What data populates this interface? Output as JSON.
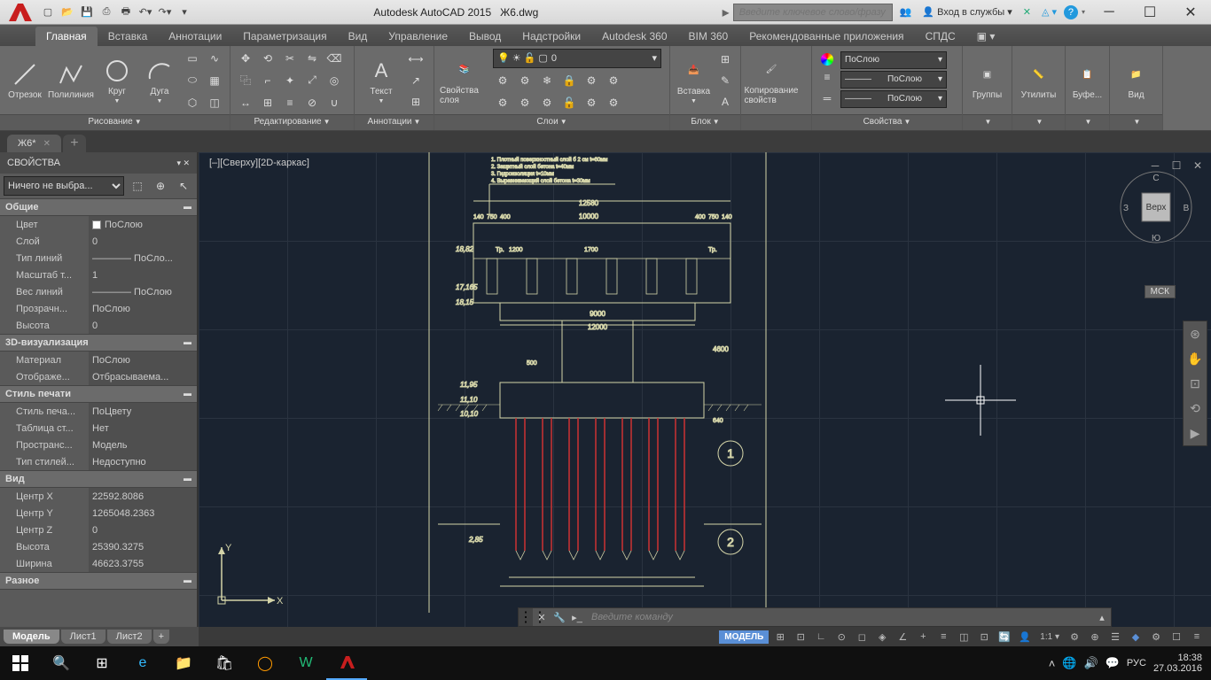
{
  "app": {
    "title": "Autodesk AutoCAD 2015",
    "filename": "Ж6.dwg",
    "search_placeholder": "Введите ключевое слово/фразу",
    "signin": "Вход в службы",
    "tabs": [
      "Главная",
      "Вставка",
      "Аннотации",
      "Параметризация",
      "Вид",
      "Управление",
      "Вывод",
      "Надстройки",
      "Autodesk 360",
      "BIM 360",
      "Рекомендованные приложения",
      "СПДС"
    ],
    "active_tab": 0
  },
  "ribbon": {
    "draw": {
      "title": "Рисование",
      "buttons": [
        "Отрезок",
        "Полилиния",
        "Круг",
        "Дуга"
      ]
    },
    "modify": {
      "title": "Редактирование"
    },
    "annot": {
      "title": "Аннотации",
      "text": "Текст"
    },
    "layers": {
      "title": "Слои",
      "props": "Свойства слоя",
      "combo": "0"
    },
    "block": {
      "title": "Блок",
      "insert": "Вставка"
    },
    "clipboard": {
      "copy": "Копирование свойств"
    },
    "properties": {
      "title": "Свойства",
      "bylayer": "ПоСлою",
      "bylayer2": "ПоСлою",
      "bylayer3": "ПоСлою"
    },
    "groups": {
      "title": "Группы"
    },
    "utils": {
      "title": "Утилиты"
    },
    "clip": {
      "title": "Буфе..."
    },
    "view": {
      "title": "Вид"
    }
  },
  "file_tab": {
    "name": "Ж6*"
  },
  "palette": {
    "title": "СВОЙСТВА",
    "selector": "Ничего не выбра...",
    "sections": [
      {
        "name": "Общие",
        "rows": [
          {
            "k": "Цвет",
            "v": "ПоСлою",
            "sw": true
          },
          {
            "k": "Слой",
            "v": "0"
          },
          {
            "k": "Тип линий",
            "v": "———— ПоСло..."
          },
          {
            "k": "Масштаб т...",
            "v": "1"
          },
          {
            "k": "Вес линий",
            "v": "———— ПоСлою"
          },
          {
            "k": "Прозрачн...",
            "v": "ПоСлою"
          },
          {
            "k": "Высота",
            "v": "0"
          }
        ]
      },
      {
        "name": "3D-визуализация",
        "rows": [
          {
            "k": "Материал",
            "v": "ПоСлою"
          },
          {
            "k": "Отображе...",
            "v": "Отбрасываема..."
          }
        ]
      },
      {
        "name": "Стиль печати",
        "rows": [
          {
            "k": "Стиль печа...",
            "v": "ПоЦвету"
          },
          {
            "k": "Таблица ст...",
            "v": "Нет"
          },
          {
            "k": "Пространс...",
            "v": "Модель"
          },
          {
            "k": "Тип стилей...",
            "v": "Недоступно"
          }
        ]
      },
      {
        "name": "Вид",
        "rows": [
          {
            "k": "Центр X",
            "v": "22592.8086"
          },
          {
            "k": "Центр Y",
            "v": "1265048.2363"
          },
          {
            "k": "Центр Z",
            "v": "0"
          },
          {
            "k": "Высота",
            "v": "25390.3275"
          },
          {
            "k": "Ширина",
            "v": "46623.3755"
          }
        ]
      },
      {
        "name": "Разное",
        "rows": []
      }
    ]
  },
  "canvas": {
    "view_label": "[–][Сверху][2D-каркас]",
    "wcs": "МСК",
    "viewcube": {
      "top": "Верх",
      "n": "С",
      "s": "Ю",
      "e": "В",
      "w": "З"
    },
    "cmd_placeholder": "Введите команду",
    "drawing_dims": {
      "top_total": "12580",
      "d1": "140",
      "d2": "750",
      "d3": "400",
      "d4": "10000",
      "d5": "400",
      "d6": "750",
      "d7": "140",
      "el1": "18,82",
      "tr": "Тр.",
      "sp1": "1200",
      "sp2": "1700",
      "el2": "17,165",
      "el3": "18,15",
      "bot1": "9000",
      "bot2": "12000",
      "h1": "4600",
      "h2": "500",
      "el4": "11,95",
      "el5": "11,10",
      "el6": "10,10",
      "d640": "640",
      "circle1": "1",
      "circle2": "2",
      "d285": "2,85",
      "notes": [
        "1. Плотный поверхностный слой б 2 см t=60мм",
        "2. Защитный слой бетона t=40мм",
        "3. Гидроизоляция t=10мм",
        "4. Выравнивающий слой бетона t=30мм"
      ]
    }
  },
  "layout_tabs": [
    "Модель",
    "Лист1",
    "Лист2"
  ],
  "status": {
    "model": "МОДЕЛЬ",
    "scale": "1:1"
  },
  "taskbar": {
    "lang": "РУС",
    "time": "18:38",
    "date": "27.03.2016"
  }
}
